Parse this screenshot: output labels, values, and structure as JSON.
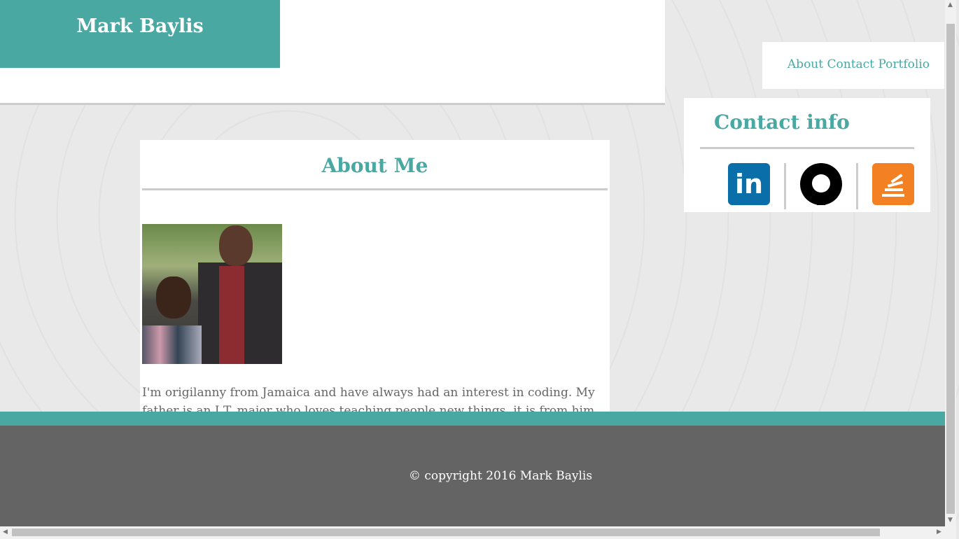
{
  "header": {
    "brand": "Mark Baylis"
  },
  "nav": {
    "items": [
      "About",
      "Contact",
      "Portfolio"
    ]
  },
  "contact": {
    "title": "Contact info",
    "icons": [
      "linkedin-icon",
      "github-icon",
      "stackoverflow-icon"
    ],
    "linkedin_text": "in"
  },
  "main": {
    "title": "About Me",
    "paragraph": "I'm origilanny from Jamaica and have always had an interest in coding. My father is an I.T. major who loves teaching people new things, it is from him that i derive my"
  },
  "footer": {
    "copyright": "© copyright 2016 Mark Baylis"
  },
  "colors": {
    "accent": "#4aa8a3",
    "footer": "#646464"
  }
}
